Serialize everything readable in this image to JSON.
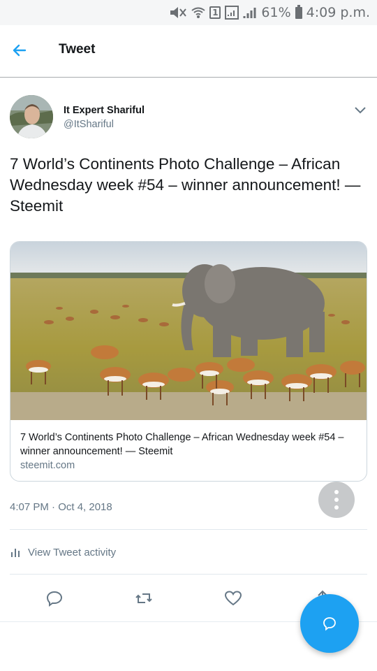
{
  "status_bar": {
    "battery_percent": "61%",
    "time": "4:09 p.m.",
    "sim_label": "1"
  },
  "header": {
    "title": "Tweet",
    "back_icon": "arrow-left-icon"
  },
  "tweet": {
    "author_name": "It Expert Shariful",
    "author_handle": "@ItShariful",
    "text": "7 World’s Continents Photo Challenge – African Wednesday week #54 – winner announcement! — Steemit",
    "timestamp": "4:07 PM · Oct 4, 2018"
  },
  "card": {
    "title": "7 World’s Continents Photo Challenge – African Wednesday week #54 – winner announcement! — Steemit",
    "domain": "steemit.com"
  },
  "activity": {
    "label": "View Tweet activity"
  },
  "actions": [
    "reply-icon",
    "retweet-icon",
    "like-icon",
    "share-icon"
  ],
  "colors": {
    "accent": "#1da1f2",
    "secondary_text": "#657786",
    "primary_text": "#14171a"
  }
}
